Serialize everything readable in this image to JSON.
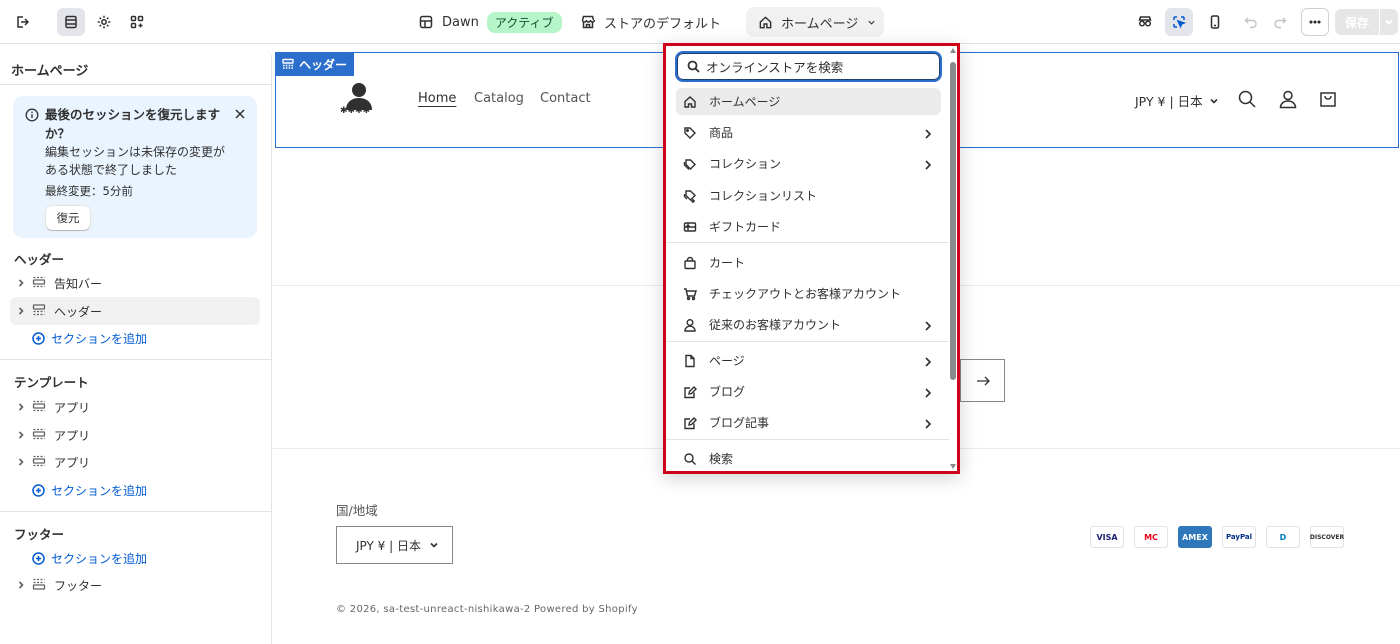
{
  "colors": {
    "accent": "#2c6ecb",
    "highlight_border": "#d0021b",
    "active_badge_bg": "#b5f5c7",
    "link": "#005bd3"
  },
  "topbar": {
    "theme_name": "Dawn",
    "theme_status": "アクティブ",
    "store_default": "ストアのデフォルト",
    "page_select": "ホームページ",
    "save_label": "保存"
  },
  "sidebar": {
    "title": "ホームページ",
    "restore": {
      "title": "最後のセッションを復元しますか？",
      "description": "編集セッションは未保存の変更がある状態で終了しました",
      "last_modified": "最終変更：5分前",
      "button": "復元"
    },
    "header_group": {
      "title": "ヘッダー",
      "items": [
        {
          "label": "告知バー"
        },
        {
          "label": "ヘッダー"
        }
      ],
      "add": "セクションを追加"
    },
    "template_group": {
      "title": "テンプレート",
      "items": [
        {
          "label": "アプリ"
        },
        {
          "label": "アプリ"
        },
        {
          "label": "アプリ"
        }
      ],
      "add": "セクションを追加"
    },
    "footer_group": {
      "title": "フッター",
      "add": "セクションを追加",
      "items": [
        {
          "label": "フッター"
        }
      ]
    }
  },
  "preview": {
    "header_tag": "ヘッダー",
    "logo_text": "✱✱✱✱",
    "nav": [
      "Home",
      "Catalog",
      "Contact"
    ],
    "currency": "JPY ¥ | 日本",
    "region_label": "国/地域",
    "region_value": "JPY ¥ | 日本",
    "payments": [
      "VISA",
      "MC",
      "AMEX",
      "PayPal",
      "D",
      "DISCOVER"
    ],
    "copyright": "© 2026, sa-test-unreact-nishikawa-2 Powered by Shopify"
  },
  "dropdown": {
    "search_placeholder": "オンラインストアを検索",
    "items": [
      {
        "label": "ホームページ",
        "icon": "home-icon"
      },
      {
        "label": "商品",
        "icon": "tag-icon"
      },
      {
        "label": "コレクション",
        "icon": "collection-icon"
      },
      {
        "label": "コレクションリスト",
        "icon": "collection-list-icon"
      },
      {
        "label": "ギフトカード",
        "icon": "gift-card-icon"
      },
      {
        "label": "カート",
        "icon": "bag-icon"
      },
      {
        "label": "チェックアウトとお客様アカウント",
        "icon": "cart-icon"
      },
      {
        "label": "従来のお客様アカウント",
        "icon": "person-icon"
      },
      {
        "label": "ページ",
        "icon": "page-icon"
      },
      {
        "label": "ブログ",
        "icon": "blog-icon"
      },
      {
        "label": "ブログ記事",
        "icon": "blog-post-icon"
      },
      {
        "label": "検索",
        "icon": "search-icon"
      }
    ]
  }
}
